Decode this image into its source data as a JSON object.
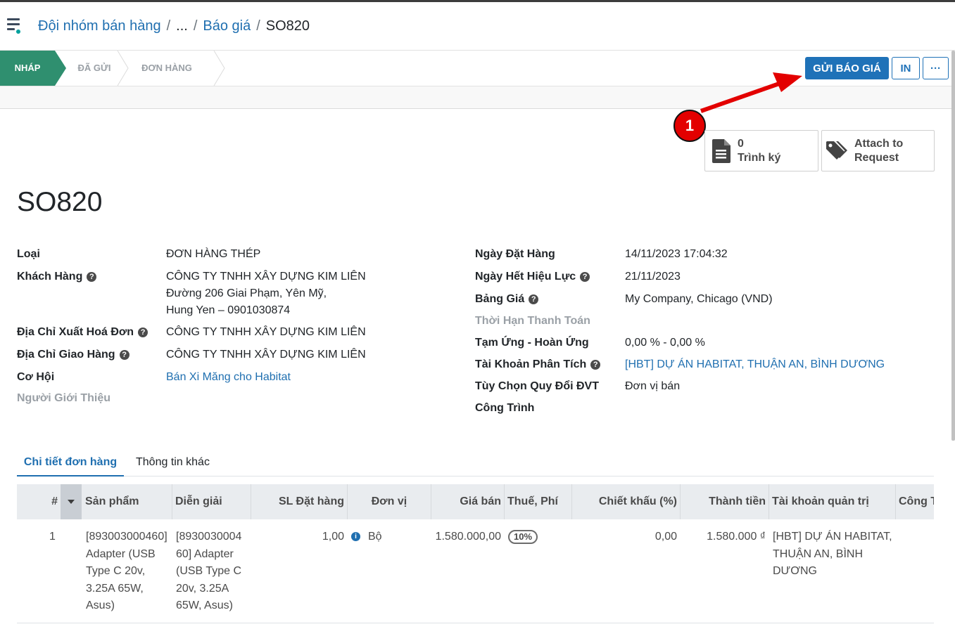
{
  "breadcrumb": {
    "items": [
      "Đội nhóm bán hàng",
      "...",
      "Báo giá"
    ],
    "separator": "/",
    "current": "SO820"
  },
  "statusbar": {
    "stages": [
      "NHÁP",
      "ĐÃ GỬI",
      "ĐƠN HÀNG"
    ],
    "active_stage": "NHÁP",
    "buttons": {
      "send": "GỬI BÁO GIÁ",
      "print": "IN",
      "more": "···"
    }
  },
  "smart_buttons": {
    "sign": {
      "count": "0",
      "label": "Trình ký"
    },
    "attach": {
      "line1": "Attach to",
      "line2": "Request"
    }
  },
  "annotation": {
    "number": "1",
    "color": "#e30000"
  },
  "record": {
    "name": "SO820"
  },
  "left_fields": {
    "loai": {
      "label": "Loại",
      "value": "ĐƠN HÀNG THÉP"
    },
    "khach_hang": {
      "label": "Khách Hàng",
      "value_lines": [
        "CÔNG TY TNHH XÂY DỰNG KIM LIÊN",
        "Đường 206 Giai Phạm, Yên Mỹ,",
        "Hung Yen – 0901030874"
      ]
    },
    "dia_chi_hoa_don": {
      "label": "Địa Chỉ Xuất Hoá Đơn",
      "value": "CÔNG TY TNHH XÂY DỰNG KIM LIÊN"
    },
    "dia_chi_giao_hang": {
      "label": "Địa Chỉ Giao Hàng",
      "value": "CÔNG TY TNHH XÂY DỰNG KIM LIÊN"
    },
    "co_hoi": {
      "label": "Cơ Hội",
      "value": "Bán Xi Măng cho Habitat"
    },
    "nguoi_gioi_thieu": {
      "label": "Người Giới Thiệu",
      "value": ""
    }
  },
  "right_fields": {
    "ngay_dat_hang": {
      "label": "Ngày Đặt Hàng",
      "value": "14/11/2023 17:04:32"
    },
    "ngay_het_hieu_luc": {
      "label": "Ngày Hết Hiệu Lực",
      "value": "21/11/2023"
    },
    "bang_gia": {
      "label": "Bảng Giá",
      "value": "My Company, Chicago (VND)"
    },
    "thoi_han_thanh_toan": {
      "label": "Thời Hạn Thanh Toán",
      "value": ""
    },
    "tam_ung": {
      "label": "Tạm Ứng - Hoàn Ứng",
      "value": "0,00 % - 0,00 %"
    },
    "tai_khoan_phan_tich": {
      "label": "Tài Khoản Phân Tích",
      "value": "[HBT] DỰ ÁN HABITAT, THUẬN AN, BÌNH DƯƠNG"
    },
    "tuy_chon_quy_doi": {
      "label": "Tùy Chọn Quy Đổi ĐVT",
      "value": "Đơn vị bán"
    },
    "cong_trinh": {
      "label": "Công Trình",
      "value": ""
    }
  },
  "tabs": [
    "Chi tiết đơn hàng",
    "Thông tin khác"
  ],
  "table": {
    "columns": [
      "#",
      "Sản phẩm",
      "Diễn giải",
      "SL Đặt hàng",
      "Đơn vị",
      "Giá bán",
      "Thuế, Phí",
      "Chiết khấu (%)",
      "Thành tiền",
      "Tài khoản quản trị",
      "Công T"
    ],
    "rows": [
      {
        "index": "1",
        "product_lines": [
          "[893003000460]",
          "Adapter (USB",
          "Type C 20v,",
          "3.25A 65W,",
          "Asus)"
        ],
        "desc_lines": [
          "[8930030004",
          "60] Adapter",
          "(USB Type C",
          "20v, 3.25A",
          "65W, Asus)"
        ],
        "qty": "1,00",
        "uom": "Bộ",
        "price": "1.580.000,00",
        "tax": "10%",
        "discount": "0,00",
        "subtotal": "1.580.000 ₫",
        "account_lines": [
          "[HBT] DỰ ÁN HABITAT,",
          "THUẬN AN, BÌNH",
          "DƯƠNG"
        ]
      }
    ]
  }
}
